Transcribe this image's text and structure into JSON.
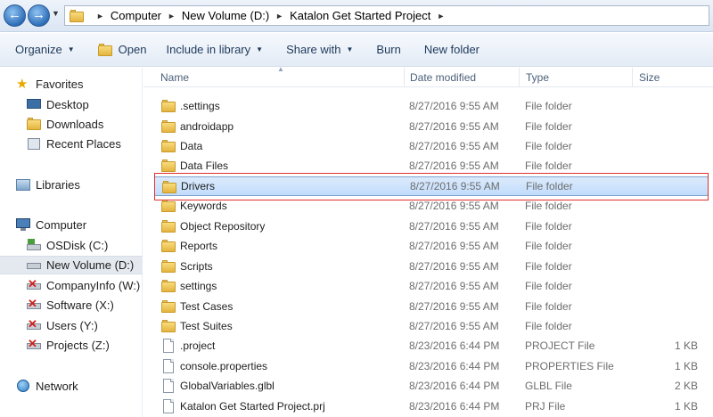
{
  "address": {
    "crumbs": [
      "Computer",
      "New Volume (D:)",
      "Katalon Get Started Project"
    ]
  },
  "toolbar": {
    "organize": "Organize",
    "open": "Open",
    "include": "Include in library",
    "share": "Share with",
    "burn": "Burn",
    "new_folder": "New folder"
  },
  "nav": {
    "favorites": "Favorites",
    "desktop": "Desktop",
    "downloads": "Downloads",
    "recent": "Recent Places",
    "libraries": "Libraries",
    "computer": "Computer",
    "osdisk": "OSDisk (C:)",
    "newvolume": "New Volume (D:)",
    "companyinfo": "CompanyInfo (W:)",
    "software": "Software (X:)",
    "users": "Users (Y:)",
    "projects": "Projects (Z:)",
    "network": "Network"
  },
  "columns": {
    "name": "Name",
    "date": "Date modified",
    "type": "Type",
    "size": "Size"
  },
  "files": [
    {
      "name": ".settings",
      "date": "8/27/2016 9:55 AM",
      "type": "File folder",
      "size": "",
      "kind": "folder"
    },
    {
      "name": "androidapp",
      "date": "8/27/2016 9:55 AM",
      "type": "File folder",
      "size": "",
      "kind": "folder"
    },
    {
      "name": "Data",
      "date": "8/27/2016 9:55 AM",
      "type": "File folder",
      "size": "",
      "kind": "folder"
    },
    {
      "name": "Data Files",
      "date": "8/27/2016 9:55 AM",
      "type": "File folder",
      "size": "",
      "kind": "folder"
    },
    {
      "name": "Drivers",
      "date": "8/27/2016 9:55 AM",
      "type": "File folder",
      "size": "",
      "kind": "folder",
      "selected": true
    },
    {
      "name": "Keywords",
      "date": "8/27/2016 9:55 AM",
      "type": "File folder",
      "size": "",
      "kind": "folder"
    },
    {
      "name": "Object Repository",
      "date": "8/27/2016 9:55 AM",
      "type": "File folder",
      "size": "",
      "kind": "folder"
    },
    {
      "name": "Reports",
      "date": "8/27/2016 9:55 AM",
      "type": "File folder",
      "size": "",
      "kind": "folder"
    },
    {
      "name": "Scripts",
      "date": "8/27/2016 9:55 AM",
      "type": "File folder",
      "size": "",
      "kind": "folder"
    },
    {
      "name": "settings",
      "date": "8/27/2016 9:55 AM",
      "type": "File folder",
      "size": "",
      "kind": "folder"
    },
    {
      "name": "Test Cases",
      "date": "8/27/2016 9:55 AM",
      "type": "File folder",
      "size": "",
      "kind": "folder"
    },
    {
      "name": "Test Suites",
      "date": "8/27/2016 9:55 AM",
      "type": "File folder",
      "size": "",
      "kind": "folder"
    },
    {
      "name": ".project",
      "date": "8/23/2016 6:44 PM",
      "type": "PROJECT File",
      "size": "1 KB",
      "kind": "file"
    },
    {
      "name": "console.properties",
      "date": "8/23/2016 6:44 PM",
      "type": "PROPERTIES File",
      "size": "1 KB",
      "kind": "file"
    },
    {
      "name": "GlobalVariables.glbl",
      "date": "8/23/2016 6:44 PM",
      "type": "GLBL File",
      "size": "2 KB",
      "kind": "file"
    },
    {
      "name": "Katalon Get Started Project.prj",
      "date": "8/23/2016 6:44 PM",
      "type": "PRJ File",
      "size": "1 KB",
      "kind": "file"
    }
  ]
}
